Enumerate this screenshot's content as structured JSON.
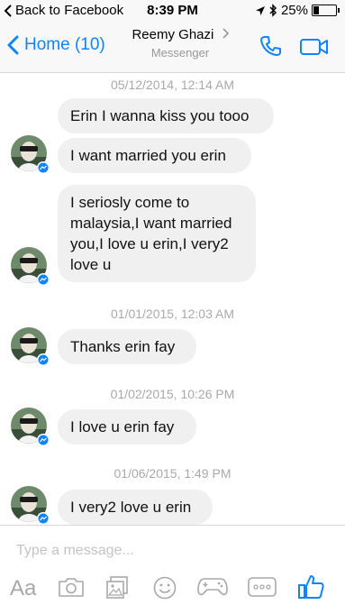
{
  "status_bar": {
    "back_label": "Back to Facebook",
    "time": "8:39 PM",
    "battery_text": "25%",
    "battery_level": 0.25
  },
  "nav": {
    "back_label": "Home (10)",
    "contact_name": "Reemy Ghazi",
    "subtitle": "Messenger",
    "accent_color": "#1083fe"
  },
  "messages": {
    "timestamps": [
      "05/12/2014, 12:14 AM",
      "01/01/2015, 12:03 AM",
      "01/02/2015, 10:26 PM",
      "01/06/2015, 1:49 PM"
    ],
    "bubbles": [
      "Erin I wanna kiss you tooo",
      "I want married you erin",
      "I seriosly come to malaysia,I want married you,I love u erin,I very2 love u",
      "Thanks erin fay",
      "I love u erin fay",
      "I very2 love u erin"
    ]
  },
  "composer": {
    "placeholder": "Type a message...",
    "text_format_label": "Aa",
    "icons": [
      "camera-icon",
      "photo-gallery-icon",
      "emoji-icon",
      "game-controller-icon",
      "more-options-icon",
      "thumbs-up-icon"
    ]
  }
}
